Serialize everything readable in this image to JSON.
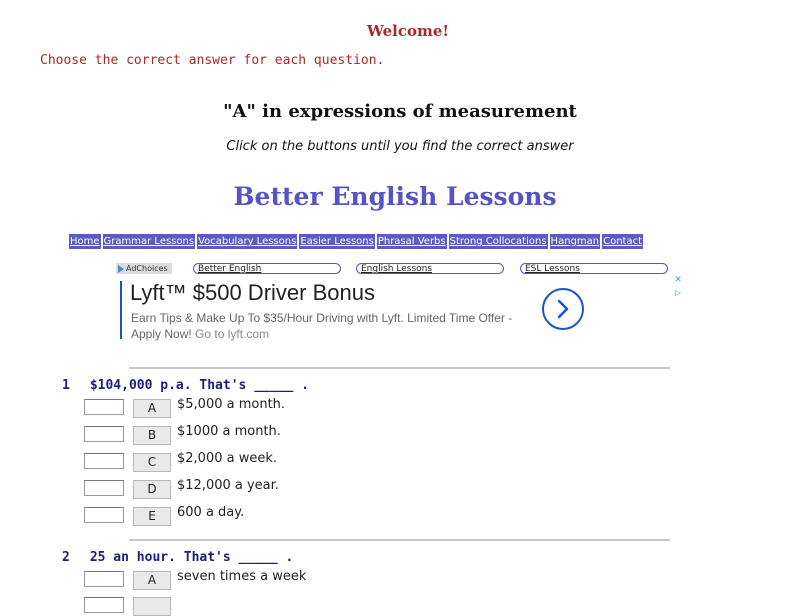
{
  "header": {
    "welcome": "Welcome!",
    "instructions": "Choose the correct answer for each question."
  },
  "exercise": {
    "title": "\"A\" in expressions of measurement",
    "subtitle": "Click on the buttons until you find the correct answer"
  },
  "brand": "Better English Lessons",
  "nav": [
    "Home",
    "Grammar Lessons",
    "Vocabulary Lessons",
    "Easier Lessons",
    "Phrasal Verbs",
    "Strong Collocations",
    "Hangman",
    "Contact"
  ],
  "ad_links": {
    "adchoices": "AdChoices",
    "links": [
      "Better English",
      "English Lessons",
      "ESL Lessons"
    ]
  },
  "ad": {
    "title": "Lyft™ $500 Driver Bonus",
    "desc": "Earn Tips & Make Up To $35/Hour Driving with Lyft. Limited Time Offer - Apply Now!",
    "url": "Go to lyft.com",
    "colors": {
      "accent": "#1a55c8"
    },
    "icons": [
      "chevron-right-icon",
      "close-icon",
      "adchoices-icon"
    ]
  },
  "questions": [
    {
      "number": "1",
      "text": "$104,000 p.a. That's _____ .",
      "options": [
        {
          "label": "A",
          "text": "$5,000 a month."
        },
        {
          "label": "B",
          "text": "$1000 a month."
        },
        {
          "label": "C",
          "text": "$2,000 a week."
        },
        {
          "label": "D",
          "text": "$12,000 a year."
        },
        {
          "label": "E",
          "text": "600 a day."
        }
      ]
    },
    {
      "number": "2",
      "text": "25 an hour. That's _____ .",
      "options": [
        {
          "label": "A",
          "text": "seven times a week"
        }
      ]
    }
  ]
}
